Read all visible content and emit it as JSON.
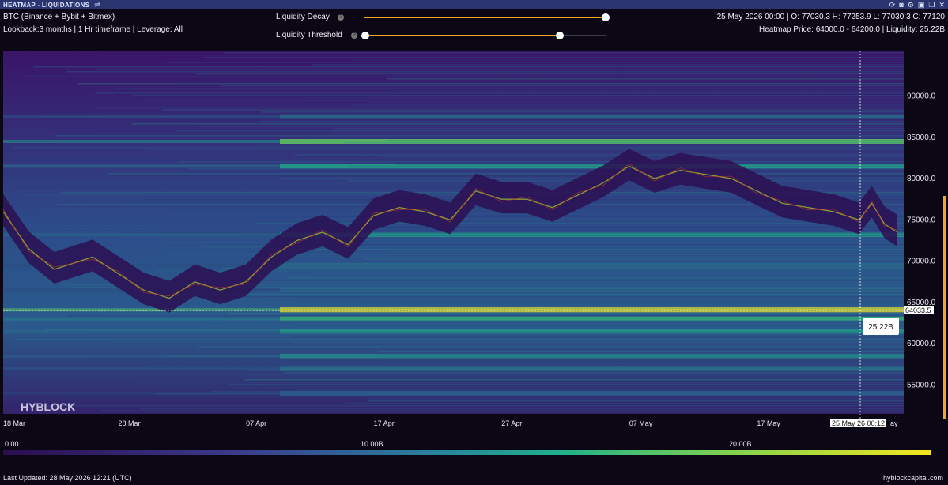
{
  "titlebar": {
    "title": "HEATMAP - LIQUIDATIONS",
    "icons": [
      "settings-sliders-icon",
      "refresh-icon",
      "camera-icon",
      "gear-icon",
      "save-icon",
      "copy-icon",
      "close-icon"
    ]
  },
  "info": {
    "exchange": "BTC (Binance + Bybit + Bitmex)",
    "lookback": "Lookback:3 months | 1 Hr timeframe | Leverage: All",
    "ohlc": "25 May 2026 00:00 | O: 77030.3 H: 77253.9 L: 77030.3 C: 77120",
    "heatmap_price": "Heatmap Price: 64000.0 - 64200.0 | Liquidity: 25.22B"
  },
  "sliders": {
    "decay_label": "Liquidity Decay",
    "decay_value": 1.0,
    "threshold_label": "Liquidity Threshold",
    "threshold_value": 0.81,
    "help_glyph": "?"
  },
  "chart_data": {
    "type": "heatmap",
    "y_ticks": [
      "90000.0",
      "85000.0",
      "80000.0",
      "75000.0",
      "70000.0",
      "65000.0",
      "60000.0",
      "55000.0"
    ],
    "ylim": [
      51500,
      95500
    ],
    "x_ticks": [
      "18 Mar",
      "28 Mar",
      "07 Apr",
      "17 Apr",
      "27 Apr",
      "07 May",
      "17 May"
    ],
    "crosshair_time": "25 May 26 00:12",
    "crosshair_suffix": "ay",
    "crosshair_price": "64033.5",
    "crosshair_tooltip": "25.22B",
    "watermark": "HYBLOCK",
    "price_path": [
      [
        "18 Mar",
        76000
      ],
      [
        "20 Mar",
        71500
      ],
      [
        "22 Mar",
        69000
      ],
      [
        "25 Mar",
        70500
      ],
      [
        "27 Mar",
        68500
      ],
      [
        "29 Mar",
        66500
      ],
      [
        "31 Mar",
        65500
      ],
      [
        "02 Apr",
        67500
      ],
      [
        "04 Apr",
        66500
      ],
      [
        "06 Apr",
        67500
      ],
      [
        "08 Apr",
        70500
      ],
      [
        "10 Apr",
        72500
      ],
      [
        "12 Apr",
        73500
      ],
      [
        "14 Apr",
        72000
      ],
      [
        "16 Apr",
        75500
      ],
      [
        "18 Apr",
        76500
      ],
      [
        "20 Apr",
        76000
      ],
      [
        "22 Apr",
        75000
      ],
      [
        "24 Apr",
        78500
      ],
      [
        "26 Apr",
        77500
      ],
      [
        "28 Apr",
        77500
      ],
      [
        "30 Apr",
        76500
      ],
      [
        "02 May",
        78000
      ],
      [
        "04 May",
        79500
      ],
      [
        "06 May",
        81500
      ],
      [
        "08 May",
        80000
      ],
      [
        "10 May",
        81000
      ],
      [
        "12 May",
        80500
      ],
      [
        "14 May",
        80000
      ],
      [
        "16 May",
        78500
      ],
      [
        "18 May",
        77000
      ],
      [
        "20 May",
        76500
      ],
      [
        "22 May",
        76000
      ],
      [
        "24 May",
        75000
      ],
      [
        "25 May",
        77000
      ],
      [
        "26 May",
        74500
      ],
      [
        "27 May",
        73500
      ]
    ],
    "bands": [
      {
        "price": 64100,
        "level": 1.0
      },
      {
        "price": 84500,
        "level": 0.7
      },
      {
        "price": 63000,
        "level": 0.6
      },
      {
        "price": 61500,
        "level": 0.5
      },
      {
        "price": 58500,
        "level": 0.45
      },
      {
        "price": 57000,
        "level": 0.4
      },
      {
        "price": 73200,
        "level": 0.5
      },
      {
        "price": 81500,
        "level": 0.55
      },
      {
        "price": 87500,
        "level": 0.35
      },
      {
        "price": 69500,
        "level": 0.35
      },
      {
        "price": 54000,
        "level": 0.3
      },
      {
        "price": 66500,
        "level": 0.35
      }
    ]
  },
  "legend": {
    "min_label": "0.00",
    "mid_label": "10.00B",
    "max_label": "20.00B"
  },
  "footer": {
    "last_updated": "Last Updated: 28 May 2026 12:21 (UTC)",
    "site": "hyblockcapital.com"
  }
}
